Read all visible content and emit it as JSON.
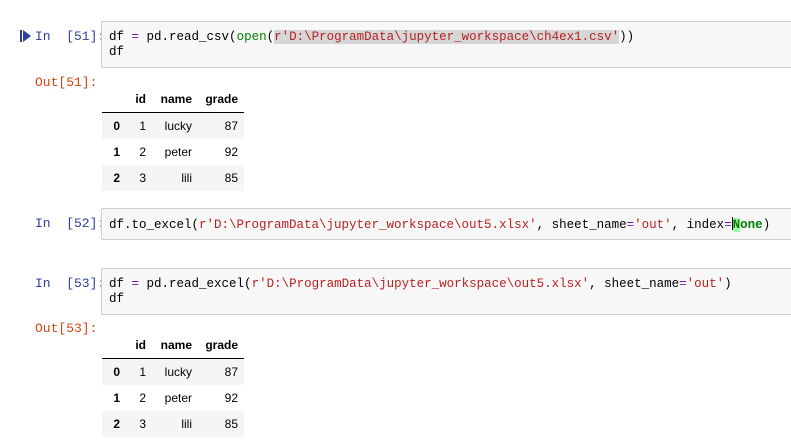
{
  "cells": [
    {
      "in_prompt": "In  [51]:",
      "out_prompt": "Out[51]:",
      "code": {
        "line1": {
          "a": "df ",
          "op_eq": "=",
          "b": " pd.read_csv(",
          "builtin": "open",
          "c": "(",
          "str": "r'D:\\ProgramData\\jupyter_workspace\\ch4ex1.csv'",
          "d": "))"
        },
        "line2": "df"
      },
      "table": {
        "columns": [
          "",
          "id",
          "name",
          "grade"
        ],
        "rows": [
          {
            "index": "0",
            "id": "1",
            "name": "lucky",
            "grade": "87"
          },
          {
            "index": "1",
            "id": "2",
            "name": "peter",
            "grade": "92"
          },
          {
            "index": "2",
            "id": "3",
            "name": "lili",
            "grade": "85"
          }
        ]
      }
    },
    {
      "in_prompt": "In  [52]:",
      "code": {
        "line1": {
          "a": "df.to_excel(",
          "str1": "r'D:\\ProgramData\\jupyter_workspace\\out5.xlsx'",
          "b": ", sheet_name",
          "op_eq": "=",
          "str2": "'out'",
          "c": ", index",
          "op_eq2": "=",
          "kw_hl": "N",
          "kw": "one",
          "d": ")"
        }
      }
    },
    {
      "in_prompt": "In  [53]:",
      "out_prompt": "Out[53]:",
      "code": {
        "line1": {
          "a": "df ",
          "op_eq": "=",
          "b": " pd.read_excel(",
          "str1": "r'D:\\ProgramData\\jupyter_workspace\\out5.xlsx'",
          "c": ", sheet_name",
          "op_eq2": "=",
          "str2": "'out'",
          "d": ")"
        },
        "line2": "df"
      },
      "table": {
        "columns": [
          "",
          "id",
          "name",
          "grade"
        ],
        "rows": [
          {
            "index": "0",
            "id": "1",
            "name": "lucky",
            "grade": "87"
          },
          {
            "index": "1",
            "id": "2",
            "name": "peter",
            "grade": "92"
          },
          {
            "index": "2",
            "id": "3",
            "name": "lili",
            "grade": "85"
          }
        ]
      }
    }
  ],
  "colors": {
    "in_prompt": "#303f9f",
    "out_prompt": "#d84315",
    "code_bg": "#f7f7f7",
    "string": "#ba2121",
    "keyword": "#008000",
    "operator": "#7216ab"
  },
  "icons": {
    "run": "run-cell-icon"
  }
}
